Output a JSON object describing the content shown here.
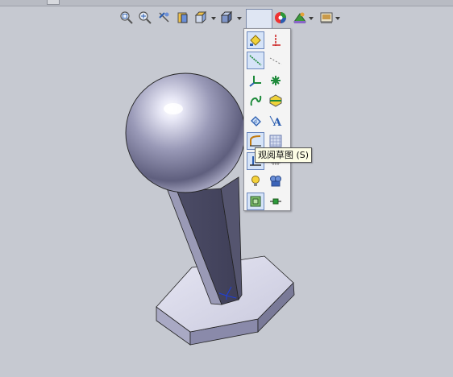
{
  "viewport": {
    "background": "#c6c9d1"
  },
  "heads_up_toolbar": {
    "buttons": [
      {
        "name": "zoom-to-fit-icon",
        "has_dropdown": false
      },
      {
        "name": "zoom-to-area-icon",
        "has_dropdown": false
      },
      {
        "name": "previous-view-icon",
        "has_dropdown": false
      },
      {
        "name": "section-view-icon",
        "has_dropdown": false
      },
      {
        "name": "view-orientation-icon",
        "has_dropdown": true
      },
      {
        "name": "display-style-icon",
        "has_dropdown": true
      },
      {
        "name": "hide-show-items-icon",
        "has_dropdown": true
      },
      {
        "name": "edit-appearance-icon",
        "has_dropdown": false
      },
      {
        "name": "apply-scene-icon",
        "has_dropdown": true
      },
      {
        "name": "view-settings-icon",
        "has_dropdown": true
      }
    ]
  },
  "hide_show_flyout": {
    "items": [
      {
        "name": "view-planes-icon",
        "selected": true
      },
      {
        "name": "view-axes-icon",
        "selected": false
      },
      {
        "name": "view-temporary-axes-icon",
        "selected": true
      },
      {
        "name": "view-origins-icon",
        "selected": false
      },
      {
        "name": "view-coordinate-systems-icon",
        "selected": false
      },
      {
        "name": "view-points-icon",
        "selected": false
      },
      {
        "name": "view-curves-icon",
        "selected": false
      },
      {
        "name": "view-parting-lines-icon",
        "selected": false
      },
      {
        "name": "view-sketch-dimensions-icon",
        "selected": false
      },
      {
        "name": "view-annotations-icon",
        "selected": false
      },
      {
        "name": "view-sketches-icon",
        "selected": true
      },
      {
        "name": "view-sketch-relations-icon",
        "selected": false
      },
      {
        "name": "view-sketch-planes-icon",
        "selected": true
      },
      {
        "name": "view-grid-icon",
        "selected": false
      },
      {
        "name": "view-lights-icon",
        "selected": false
      },
      {
        "name": "view-cameras-icon",
        "selected": false
      },
      {
        "name": "view-all-types-icon",
        "selected": true
      },
      {
        "name": "view-mates-icon",
        "selected": false
      }
    ]
  },
  "tooltip": {
    "text": "观阅草图 (S)"
  }
}
